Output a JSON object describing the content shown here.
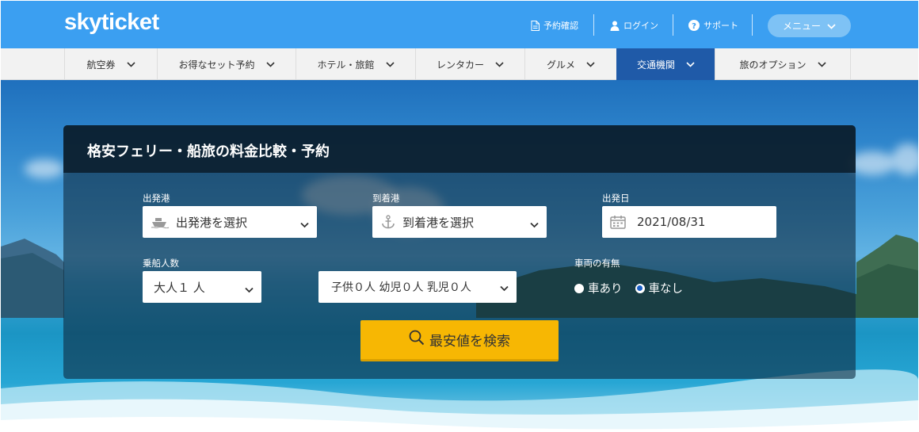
{
  "header": {
    "logo": "skyticket",
    "links": [
      {
        "label": "予約確認",
        "icon": "document-icon"
      },
      {
        "label": "ログイン",
        "icon": "user-icon"
      },
      {
        "label": "サポート",
        "icon": "help-icon"
      }
    ],
    "menu_label": "メニュー"
  },
  "nav": {
    "items": [
      {
        "label": "航空券"
      },
      {
        "label": "お得なセット予約"
      },
      {
        "label": "ホテル・旅館"
      },
      {
        "label": "レンタカー"
      },
      {
        "label": "グルメ"
      },
      {
        "label": "交通機関",
        "active": true
      },
      {
        "label": "旅のオプション"
      }
    ]
  },
  "search": {
    "title": "格安フェリー・船旅の料金比較・予約",
    "departure": {
      "label": "出発港",
      "placeholder": "出発港を選択",
      "icon": "ship-icon"
    },
    "arrival": {
      "label": "到着港",
      "placeholder": "到着港を選択",
      "icon": "anchor-icon"
    },
    "date": {
      "label": "出発日",
      "value": "2021/08/31",
      "icon": "calendar-icon"
    },
    "passengers": {
      "label": "乗船人数",
      "adults": "大人１ 人",
      "others": "子供０人 幼児０人 乳児０人"
    },
    "vehicle": {
      "label": "車両の有無",
      "options": [
        {
          "label": "車あり",
          "checked": false
        },
        {
          "label": "車なし",
          "checked": true
        }
      ]
    },
    "submit_label": "最安値を検索"
  },
  "colors": {
    "header_bg": "#3b9ff1",
    "nav_active": "#1f5aa8",
    "search_button": "#f7b703",
    "radio_checked": "#1a5fc7"
  }
}
